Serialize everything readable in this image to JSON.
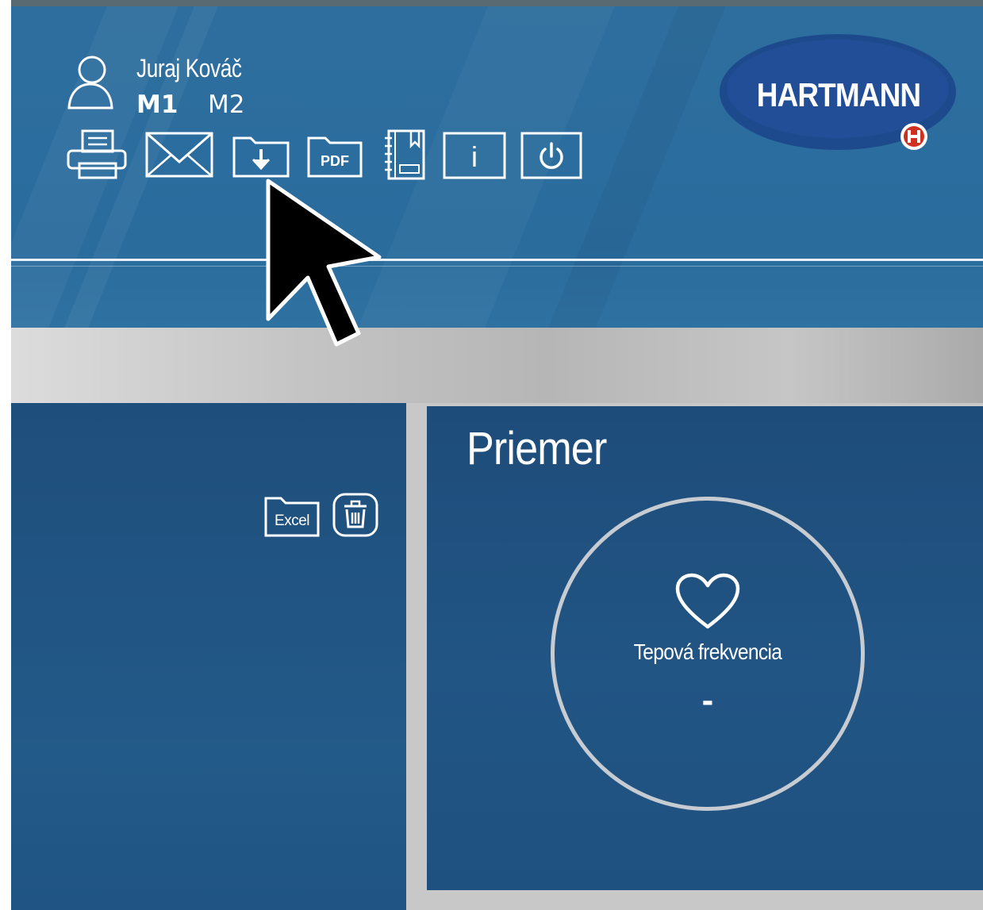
{
  "header": {
    "user": {
      "name": "Juraj Kováč",
      "icon": "user-icon"
    },
    "modes": [
      {
        "label": "M1",
        "active": true
      },
      {
        "label": "M2",
        "active": false
      }
    ],
    "toolbar": [
      {
        "icon": "printer-icon"
      },
      {
        "icon": "envelope-icon"
      },
      {
        "icon": "folder-download-icon"
      },
      {
        "icon": "pdf-folder-icon",
        "label": "PDF"
      },
      {
        "icon": "notebook-icon"
      },
      {
        "icon": "info-icon",
        "label": "i"
      },
      {
        "icon": "power-icon"
      }
    ],
    "logo": {
      "text": "HARTMANN",
      "badge": "H"
    }
  },
  "left_panel": {
    "excel_label": "Excel",
    "trash_icon": "trash-icon"
  },
  "main": {
    "title": "Priemer",
    "gauge": {
      "icon": "heart-icon",
      "label": "Tepová frekvencia",
      "value": "-"
    }
  },
  "colors": {
    "header_blue": "#2e6e9e",
    "panel_blue": "#215584",
    "logo_blue": "#1d4a8c",
    "badge_red": "#d03020",
    "gauge_ring": "#c7ccd2"
  },
  "cursor": {
    "icon": "mouse-pointer-icon"
  }
}
